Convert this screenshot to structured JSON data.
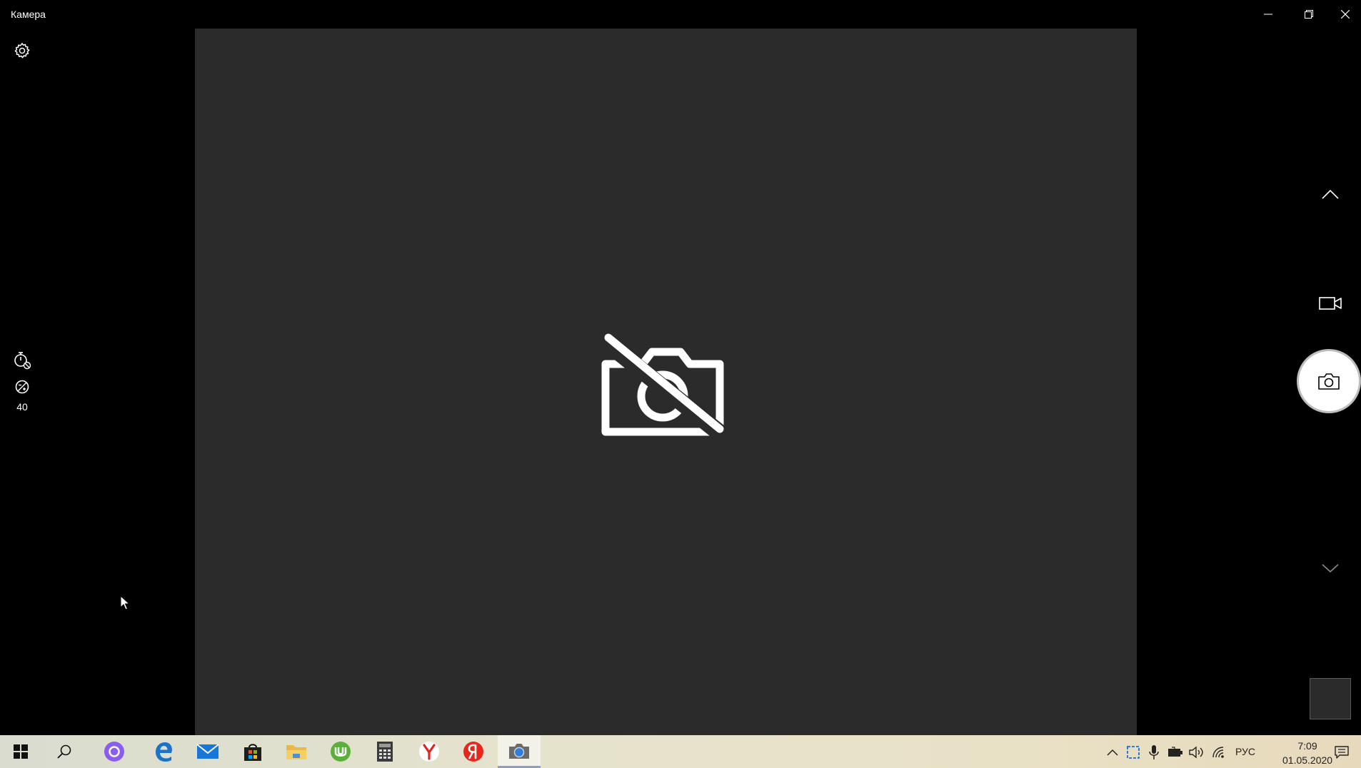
{
  "window": {
    "title": "Камера",
    "buttons": {
      "minimize": "minimize-icon",
      "maximize": "restore-icon",
      "close": "close-icon"
    }
  },
  "left_toolbar": {
    "settings_icon": "gear-icon",
    "timer_icon": "timer-off-icon",
    "exposure_icon": "exposure-icon",
    "exposure_value": "40"
  },
  "right_toolbar": {
    "up_icon": "chevron-up-icon",
    "video_icon": "video-camera-icon",
    "shutter_icon": "camera-icon",
    "down_icon": "chevron-down-icon"
  },
  "preview": {
    "status_icon": "camera-off-icon",
    "background": "#2b2b2b"
  },
  "taskbar": {
    "apps": [
      {
        "name": "start",
        "icon": "windows-logo-icon"
      },
      {
        "name": "search",
        "icon": "search-icon"
      },
      {
        "name": "alice",
        "icon": "alice-icon"
      },
      {
        "name": "edge",
        "icon": "edge-icon"
      },
      {
        "name": "mail",
        "icon": "mail-icon"
      },
      {
        "name": "store",
        "icon": "store-icon"
      },
      {
        "name": "explorer",
        "icon": "folder-icon"
      },
      {
        "name": "utorrent",
        "icon": "utorrent-icon"
      },
      {
        "name": "calculator",
        "icon": "calculator-icon"
      },
      {
        "name": "yandex-browser",
        "icon": "yandex-browser-icon"
      },
      {
        "name": "yandex",
        "icon": "yandex-icon"
      },
      {
        "name": "camera",
        "icon": "camera-app-icon",
        "active": true
      }
    ],
    "tray": {
      "language": "РУС",
      "time": "7:09",
      "date": "01.05.2020"
    }
  }
}
